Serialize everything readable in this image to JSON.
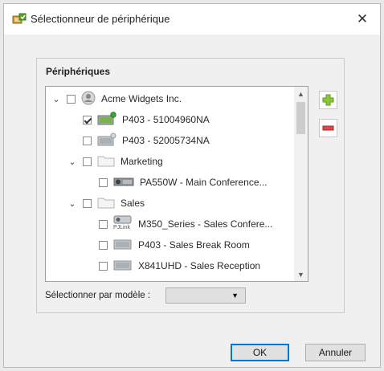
{
  "window": {
    "title": "Sélectionneur de périphérique",
    "close_glyph": "✕",
    "app_icon": "device-selector-icon"
  },
  "devices_group": {
    "title": "Périphériques",
    "tree": [
      {
        "label": "Acme Widgets Inc.",
        "level": 0,
        "type": "organization",
        "expanded": true,
        "checked": false
      },
      {
        "label": "P403 - 51004960NA",
        "level": 1,
        "type": "device-online",
        "checked": true
      },
      {
        "label": "P403 - 52005734NA",
        "level": 1,
        "type": "device",
        "checked": false
      },
      {
        "label": "Marketing",
        "level": 1,
        "type": "folder",
        "expanded": true,
        "checked": false
      },
      {
        "label": "PA550W - Main Conference...",
        "level": 2,
        "type": "projector",
        "checked": false
      },
      {
        "label": "Sales",
        "level": 1,
        "type": "folder",
        "expanded": true,
        "checked": false
      },
      {
        "label": "M350_Series - Sales Confere...",
        "level": 2,
        "type": "pjlink-projector",
        "icon_text": "PJLink",
        "checked": false
      },
      {
        "label": "P403 - Sales Break Room",
        "level": 2,
        "type": "device",
        "checked": false
      },
      {
        "label": "X841UHD - Sales Reception",
        "level": 2,
        "type": "device",
        "checked": false
      }
    ]
  },
  "side_buttons": {
    "add": "add-icon",
    "remove": "remove-icon"
  },
  "model_filter": {
    "label": "Sélectionner par modèle :",
    "value": ""
  },
  "buttons": {
    "ok": "OK",
    "cancel": "Annuler"
  },
  "colors": {
    "add": "#8cc63f",
    "remove": "#e0474c",
    "focus": "#0078d7"
  }
}
